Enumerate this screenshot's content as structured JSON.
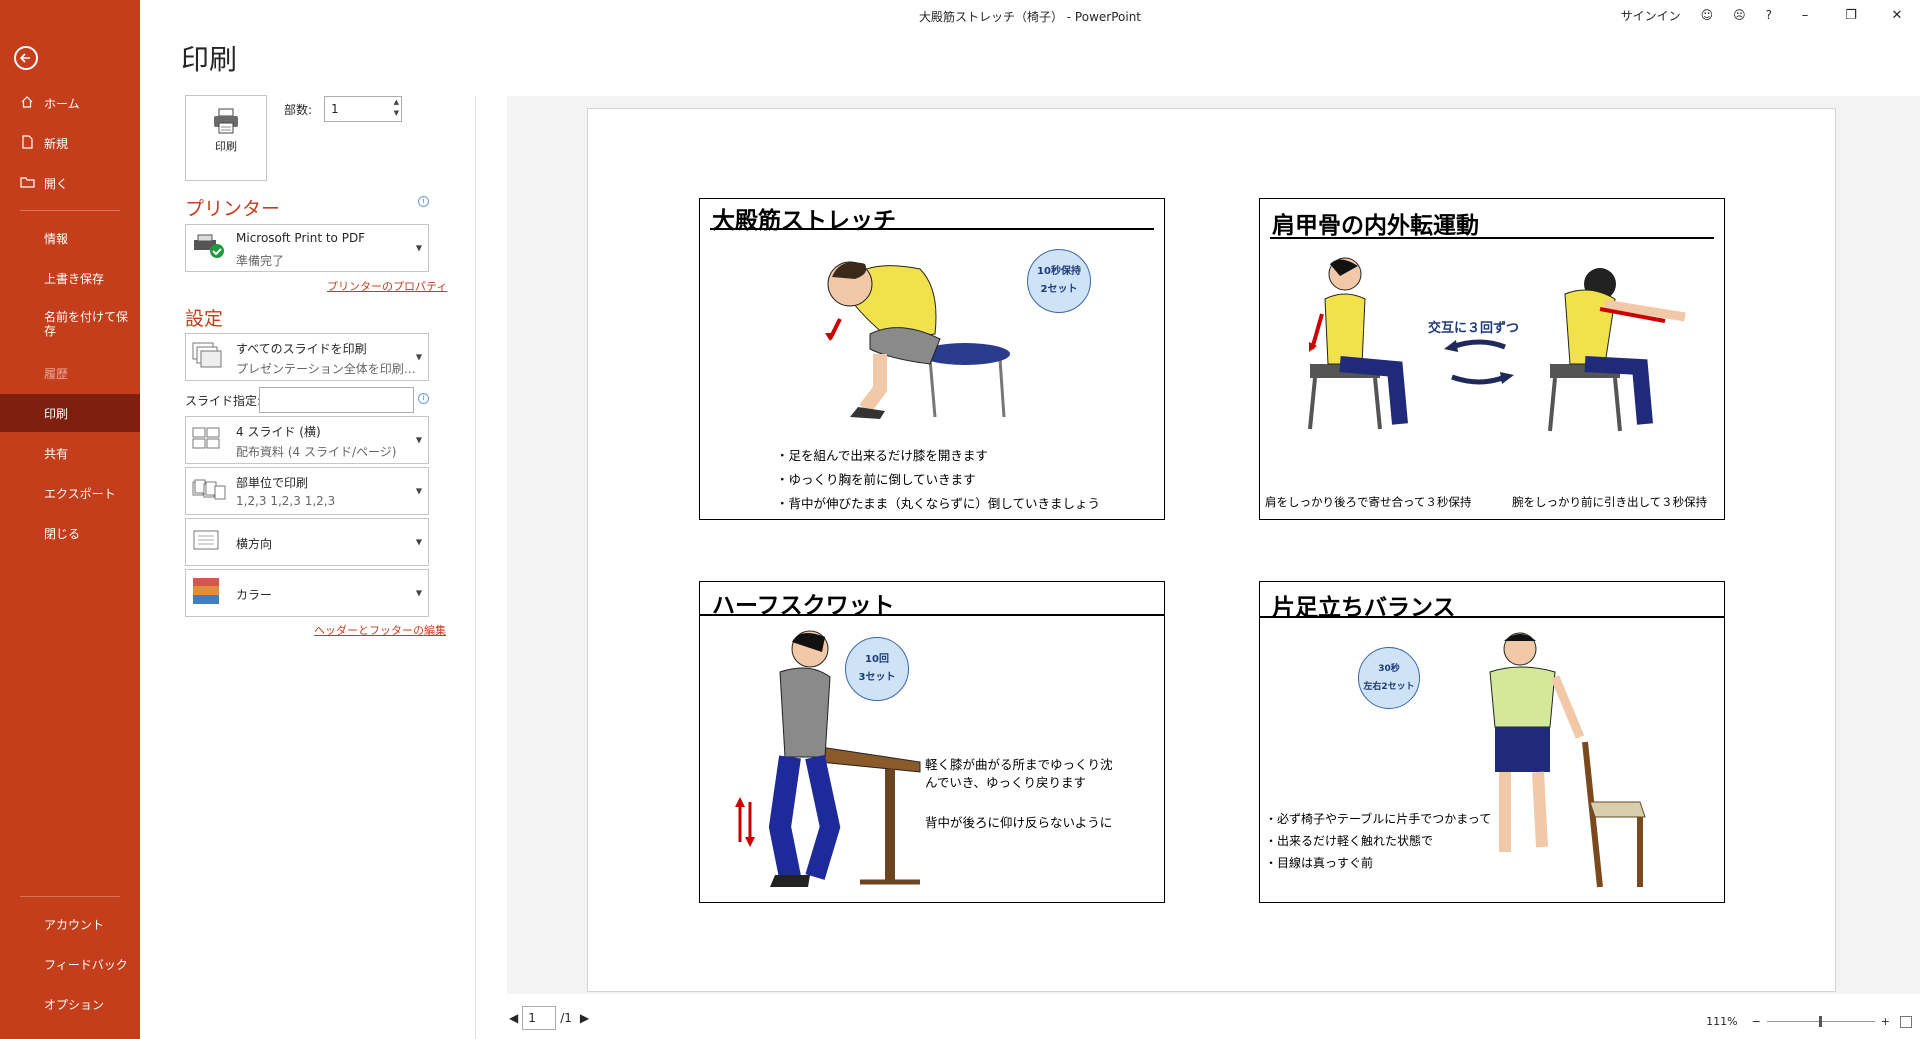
{
  "window": {
    "title": "大殿筋ストレッチ（椅子） - PowerPoint",
    "signin": "サインイン",
    "help": "?"
  },
  "sidebar": {
    "items": [
      {
        "label": "ホーム",
        "icon": "home-icon"
      },
      {
        "label": "新規",
        "icon": "new-file-icon"
      },
      {
        "label": "開く",
        "icon": "open-folder-icon"
      },
      {
        "label": "情報"
      },
      {
        "label": "上書き保存"
      },
      {
        "label": "名前を付けて保存"
      },
      {
        "label": "履歴"
      },
      {
        "label": "印刷"
      },
      {
        "label": "共有"
      },
      {
        "label": "エクスポート"
      },
      {
        "label": "閉じる"
      }
    ],
    "bottom": [
      "アカウント",
      "フィードバック",
      "オプション"
    ]
  },
  "print": {
    "heading": "印刷",
    "button_label": "印刷",
    "copies_label": "部数:",
    "copies_value": "1",
    "printer_heading": "プリンター",
    "printer_name": "Microsoft Print to PDF",
    "printer_status": "準備完了",
    "printer_properties": "プリンターのプロパティ",
    "settings_heading": "設定",
    "slides_label": "スライド指定:",
    "header_footer_link": "ヘッダーとフッターの編集",
    "settings": [
      {
        "main": "すべてのスライドを印刷",
        "sub": "プレゼンテーション全体を印刷…"
      },
      {
        "main": "4 スライド (横)",
        "sub": "配布資料 (4 スライド/ページ)"
      },
      {
        "main": "部単位で印刷",
        "sub": "1,2,3    1,2,3    1,2,3"
      },
      {
        "main": "横方向",
        "sub": ""
      },
      {
        "main": "カラー",
        "sub": ""
      }
    ]
  },
  "preview": {
    "slides": [
      {
        "title": "大殿筋ストレッチ",
        "badge": [
          "10秒保持",
          "2セット"
        ],
        "bullets": [
          "・足を組んで出来るだけ膝を開きます",
          "・ゆっくり胸を前に倒していきます",
          "・背中が伸びたまま（丸くならずに）倒していきましょう"
        ]
      },
      {
        "title": "肩甲骨の内外転運動",
        "center_text": "交互に３回ずつ",
        "captions": [
          "肩をしっかり後ろで寄せ合って３秒保持",
          "腕をしっかり前に引き出して３秒保持"
        ]
      },
      {
        "title": "ハーフスクワット",
        "badge": [
          "10回",
          "3セット"
        ],
        "bullets": [
          "軽く膝が曲がる所までゆっくり沈",
          "んでいき、ゆっくり戻ります",
          "背中が後ろに仰け反らないように"
        ]
      },
      {
        "title": "片足立ちバランス",
        "badge": [
          "30秒",
          "左右2セット"
        ],
        "bullets": [
          "・必ず椅子やテーブルに片手でつかまって",
          "・出来るだけ軽く触れた状態で",
          "・目線は真っすぐ前"
        ]
      }
    ]
  },
  "footer": {
    "page_current": "1",
    "page_total": "/1",
    "zoom": "111%"
  }
}
